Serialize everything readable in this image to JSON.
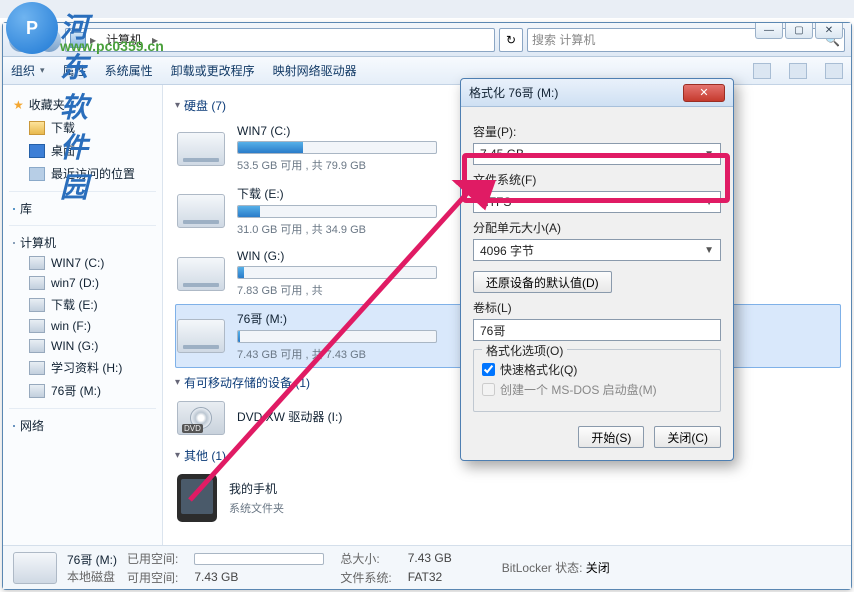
{
  "watermark": {
    "text": "河东软件园",
    "url": "www.pc0359.cn"
  },
  "breadcrumb": {
    "root_icon": "computer-icon",
    "item": "计算机"
  },
  "search": {
    "placeholder": "搜索 计算机"
  },
  "toolbar": {
    "organize": "组织",
    "properties": "属性",
    "system_props": "系统属性",
    "uninstall": "卸载或更改程序",
    "map_drive": "映射网络驱动器"
  },
  "sidebar": {
    "favorites": "收藏夹",
    "downloads": "下载",
    "desktop": "桌面",
    "recent": "最近访问的位置",
    "library": "库",
    "computer": "计算机",
    "drives": [
      {
        "label": "WIN7 (C:)"
      },
      {
        "label": "win7 (D:)"
      },
      {
        "label": "下载 (E:)"
      },
      {
        "label": "win (F:)"
      },
      {
        "label": "WIN (G:)"
      },
      {
        "label": "学习资料 (H:)"
      },
      {
        "label": "76哥 (M:)"
      }
    ],
    "network": "网络"
  },
  "categories": {
    "hdd": "硬盘 (7)",
    "removable": "有可移动存储的设备 (1)",
    "other": "其他 (1)"
  },
  "drives": [
    {
      "name": "WIN7 (C:)",
      "sub": "53.5 GB 可用 , 共 79.9 GB",
      "fill": 33
    },
    {
      "name": "下载 (E:)",
      "sub": "31.0 GB 可用 , 共 34.9 GB",
      "fill": 11
    },
    {
      "name": "WIN (G:)",
      "sub": "7.83 GB 可用 , 共",
      "fill": 3
    },
    {
      "name": "76哥 (M:)",
      "sub": "7.43 GB 可用 , 共 7.43 GB",
      "fill": 1,
      "selected": true
    }
  ],
  "removable": {
    "name": "DVD XW 驱动器 (I:)"
  },
  "other": {
    "name": "我的手机",
    "sub": "系统文件夹"
  },
  "status": {
    "title": "76哥 (M:)",
    "type": "本地磁盘",
    "used_label": "已用空间:",
    "avail_label": "可用空间:",
    "avail_value": "7.43 GB",
    "total_label": "总大小:",
    "total_value": "7.43 GB",
    "fs_label": "文件系统:",
    "fs_value": "FAT32",
    "bitlocker_label": "BitLocker 状态:",
    "bitlocker_value": "关闭"
  },
  "dialog": {
    "title": "格式化 76哥 (M:)",
    "capacity_label": "容量(P):",
    "capacity_value": "7.45 GB",
    "fs_label": "文件系统(F)",
    "fs_value": "NTFS",
    "alloc_label": "分配单元大小(A)",
    "alloc_value": "4096 字节",
    "restore_btn": "还原设备的默认值(D)",
    "volume_label_lbl": "卷标(L)",
    "volume_label_value": "76哥",
    "options_group": "格式化选项(O)",
    "quick_format": "快速格式化(Q)",
    "msdos": "创建一个 MS-DOS 启动盘(M)",
    "start_btn": "开始(S)",
    "close_btn": "关闭(C)"
  }
}
